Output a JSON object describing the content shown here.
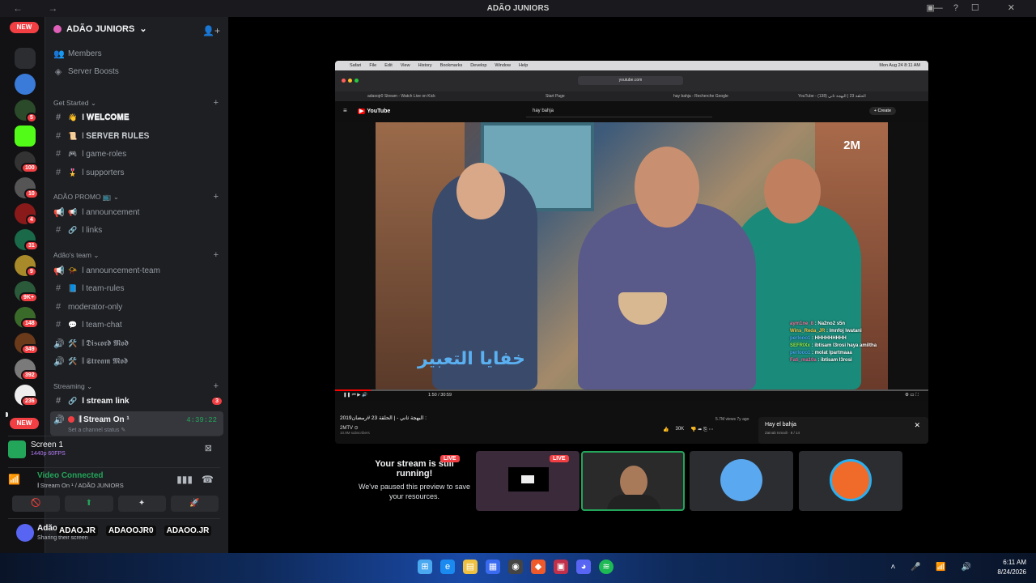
{
  "window": {
    "title": "ADÃO JUNIORS",
    "nav": "← →",
    "winctl": "— ☐ ✕",
    "tbicons": "▣ ?"
  },
  "servers": {
    "new_top": "NEW",
    "new_bottom": "NEW",
    "badges": [
      "5",
      "100",
      "10",
      "4",
      "31",
      "9",
      "9K+",
      "148",
      "349",
      "392",
      "236"
    ]
  },
  "guild": {
    "name": "ADÃO JUNIORS",
    "top_items": [
      {
        "icon": "members-icon",
        "label": "Members"
      },
      {
        "icon": "boost-icon",
        "label": "Server Boosts"
      }
    ],
    "categories": [
      {
        "name": "Get Started",
        "channels": [
          {
            "icon": "#",
            "emoji": "👋",
            "label": "l 𝐖𝐄𝐋𝐂𝐎𝐌𝐄",
            "bold": true
          },
          {
            "icon": "#",
            "emoji": "📜",
            "label": "l 𝐒𝐄𝐑𝐕𝐄𝐑 𝐑𝐔𝐋𝐄𝐒",
            "bold": false
          },
          {
            "icon": "#",
            "emoji": "🎮",
            "label": "l game-roles",
            "bold": false
          },
          {
            "icon": "#",
            "emoji": "🎖️",
            "label": "l supporters",
            "bold": false
          }
        ]
      },
      {
        "name": "ADÃO PROMO 📺",
        "channels": [
          {
            "icon": "📢",
            "emoji": "📢",
            "label": "l announcement",
            "bold": false
          },
          {
            "icon": "#",
            "emoji": "🔗",
            "label": "l links",
            "bold": false
          }
        ]
      },
      {
        "name": "Adão's team",
        "channels": [
          {
            "icon": "📢",
            "emoji": "📯",
            "label": "l announcement-team",
            "bold": false
          },
          {
            "icon": "#",
            "emoji": "📘",
            "label": "l team-rules",
            "bold": false
          },
          {
            "icon": "#",
            "emoji": "",
            "label": "moderator-only",
            "bold": false
          },
          {
            "icon": "#",
            "emoji": "💬",
            "label": "l team-chat",
            "bold": false
          },
          {
            "icon": "🔊",
            "emoji": "🛠️",
            "label": "𝄂 𝕯𝖎𝖘𝖈𝖔𝖗𝖉 𝕸𝖔𝖉",
            "bold": false
          },
          {
            "icon": "🔊",
            "emoji": "🛠️",
            "label": "𝄂 𝕾𝖙𝖗𝖊𝖆𝖒 𝕸𝖔𝖉",
            "bold": false
          }
        ]
      },
      {
        "name": "Streaming",
        "channels": [
          {
            "icon": "#",
            "emoji": "🔗",
            "label": "l stream link",
            "bold": true,
            "badge": "3"
          }
        ]
      }
    ],
    "active_channel": {
      "label": "𝄂 Stream On ¹",
      "timer": "4:39:22",
      "status_note": "Set a channel status ✎"
    }
  },
  "stream_panel": {
    "screen_title": "Screen 1",
    "screen_sub": "1440p 60FPS",
    "connection": "Video Connected",
    "connection_sub": "𝄂 Stream On ¹ / ADÃO JUNIORS",
    "buttons": [
      "🚫",
      "⬆",
      "✦",
      "🚀"
    ]
  },
  "user": {
    "name": "Adão",
    "status": "Sharing their screen",
    "socials": [
      "ADAO.JR",
      "ADAOOJR0",
      "ADAOO.JR"
    ]
  },
  "shared_screen": {
    "mac_menu": [
      "Safari",
      "File",
      "Edit",
      "View",
      "History",
      "Bookmarks",
      "Develop",
      "Window",
      "Help"
    ],
    "mac_clock": "Mon Aug 24  8:11 AM",
    "url": "youtube.com",
    "tabs": [
      "adaoojr0 Stream - Watch Live on Kick",
      "Start Page",
      "hay bahja - Recherche Google",
      "YouTube - الحلقة 23 | البهجة ثاني (138)"
    ],
    "yt_logo": "YouTube",
    "search": "hay bahja",
    "create": "+ Create",
    "brand": "2M",
    "arabic_title": "خفايا التعبير",
    "chat": [
      {
        "user": "aym1ne_8",
        "msg": ": Na2no2 s5n"
      },
      {
        "user": "Wins_Reda_JR",
        "msg": ": lmnfoj lwatani"
      },
      {
        "user": "perlooo1",
        "msg": ": HHHHHHHHH"
      },
      {
        "user": "SEFRIXx",
        "msg": ": ibtisam l3rosi haya amiltha"
      },
      {
        "user": "perlooo1",
        "msg": ": molat lpartmaaa"
      },
      {
        "user": "Fati_ma10a",
        "msg": ": ibtisam l3rosi"
      }
    ],
    "time": "1:50 / 30:59",
    "video_title": "البهجة ثاني - | الحلقة 23 #رمضان2019 :",
    "channel": "2MTV ⊙",
    "subs": "10.9M subscribers",
    "views": "5.7M views  7y ago",
    "likes": "30K",
    "upnext_title": "Hay el bahja",
    "upnext_sub": "Zainab Ismaili · 8 / 14"
  },
  "tiles": {
    "live": "LIVE",
    "paused_title": "Your stream is still running!",
    "paused_body": "We've paused this preview to save your resources."
  },
  "taskbar": {
    "tray": "˄ 🎤 📶 🔊",
    "time": "6:11 AM",
    "date": "8/24/2026"
  }
}
